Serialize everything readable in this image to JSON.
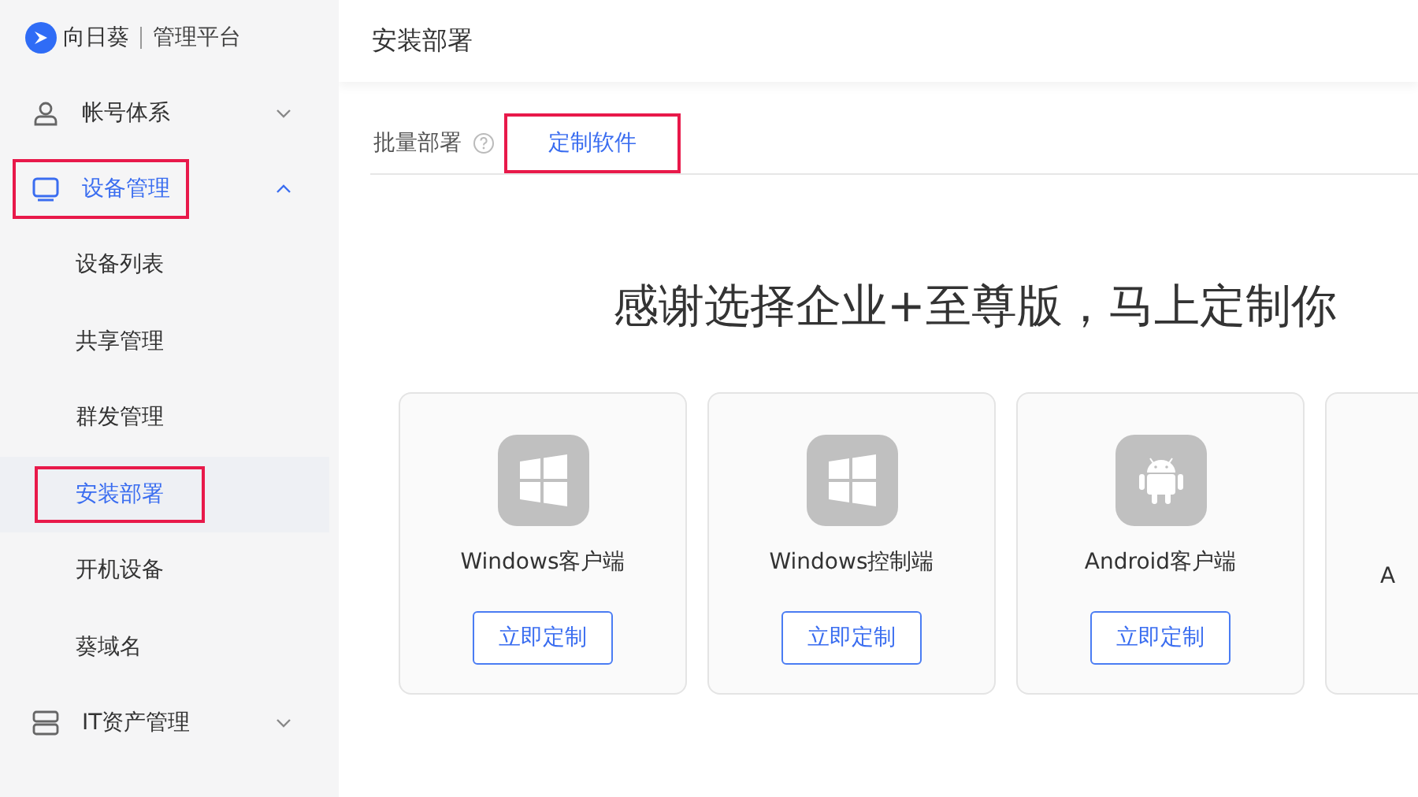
{
  "brand": {
    "name": "向日葵",
    "subtitle": "管理平台"
  },
  "sidebar": {
    "items": [
      {
        "label": "帐号体系",
        "kind": "user",
        "expanded": false,
        "highlighted": false
      },
      {
        "label": "设备管理",
        "kind": "monitor",
        "expanded": true,
        "highlighted": true,
        "children": [
          {
            "label": "设备列表",
            "selected": false,
            "highlighted": false
          },
          {
            "label": "共享管理",
            "selected": false,
            "highlighted": false
          },
          {
            "label": "群发管理",
            "selected": false,
            "highlighted": false
          },
          {
            "label": "安装部署",
            "selected": true,
            "highlighted": true
          },
          {
            "label": "开机设备",
            "selected": false,
            "highlighted": false
          },
          {
            "label": "葵域名",
            "selected": false,
            "highlighted": false
          }
        ]
      },
      {
        "label": "IT资产管理",
        "kind": "server",
        "expanded": false,
        "highlighted": false
      }
    ]
  },
  "page_title": "安装部署",
  "tabs": [
    {
      "label": "批量部署",
      "help": true,
      "selected": false,
      "highlighted": false
    },
    {
      "label": "定制软件",
      "help": false,
      "selected": true,
      "highlighted": true
    }
  ],
  "headline": "感谢选择企业+至尊版，马上定制你",
  "cards": [
    {
      "kind": "windows",
      "name": "Windows客户端",
      "button": "立即定制"
    },
    {
      "kind": "windows",
      "name": "Windows控制端",
      "button": "立即定制"
    },
    {
      "kind": "android",
      "name": "Android客户端",
      "button": "立即定制"
    },
    {
      "kind": "cut",
      "name": "A"
    }
  ]
}
